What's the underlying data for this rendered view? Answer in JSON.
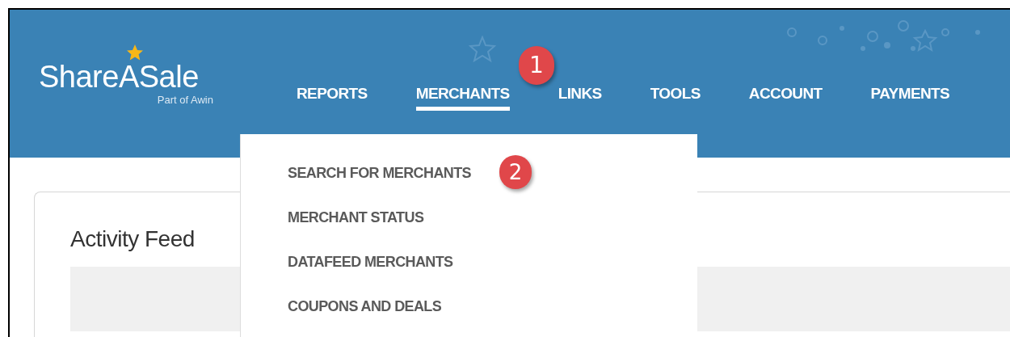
{
  "logo": {
    "name": "ShareASale",
    "tagline": "Part of Awin"
  },
  "nav": [
    {
      "label": "REPORTS",
      "selected": false
    },
    {
      "label": "MERCHANTS",
      "selected": true
    },
    {
      "label": "LINKS",
      "selected": false
    },
    {
      "label": "TOOLS",
      "selected": false
    },
    {
      "label": "ACCOUNT",
      "selected": false
    },
    {
      "label": "PAYMENTS",
      "selected": false
    }
  ],
  "dropdown": [
    "SEARCH FOR MERCHANTS",
    "MERCHANT STATUS",
    "DATAFEED MERCHANTS",
    "COUPONS AND DEALS"
  ],
  "nav_badge": "1",
  "menu_badge": "2",
  "card": {
    "title": "Activity Feed"
  }
}
